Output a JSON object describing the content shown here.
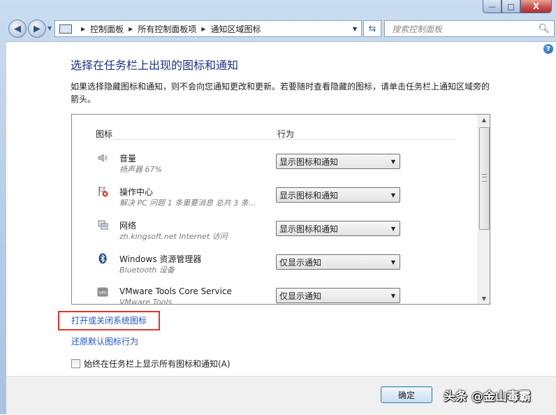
{
  "window": {
    "caption_buttons": {
      "minimize": "—",
      "maximize": "□",
      "close": "X"
    }
  },
  "nav": {
    "breadcrumbs": [
      "控制面板",
      "所有控制面板项",
      "通知区域图标"
    ],
    "search_placeholder": "搜索控制面板"
  },
  "page": {
    "title": "选择在任务栏上出现的图标和通知",
    "description": "如果选择隐藏图标和通知，则不会向您通知更改和更新。若要随时查看隐藏的图标，请单击任务栏上通知区域旁的箭头。"
  },
  "list": {
    "col_icon": "图标",
    "col_behavior": "行为",
    "rows": [
      {
        "icon": "speaker-icon",
        "name": "音量",
        "subtitle": "扬声器 67%",
        "behavior": "显示图标和通知"
      },
      {
        "icon": "action-center-icon",
        "name": "操作中心",
        "subtitle": "解决 PC 问题 1 条重要消息 总共 3 条...",
        "behavior": "显示图标和通知"
      },
      {
        "icon": "network-icon",
        "name": "网络",
        "subtitle": "zh.kingsoft.net Internet 访问",
        "behavior": "显示图标和通知"
      },
      {
        "icon": "bluetooth-icon",
        "name": "Windows 资源管理器",
        "subtitle": "Bluetooth 设备",
        "behavior": "仅显示通知"
      },
      {
        "icon": "vmware-icon",
        "name": "VMware Tools Core Service",
        "subtitle": "VMware Tools",
        "behavior": "仅显示通知"
      }
    ]
  },
  "links": {
    "system_icons": "打开或关闭系统图标",
    "restore_defaults": "还原默认图标行为"
  },
  "checkbox": {
    "label": "始终在任务栏上显示所有图标和通知(A)",
    "checked": false
  },
  "footer": {
    "ok": "确定",
    "watermark": "头条 @金山毒霸"
  },
  "colors": {
    "title": "#1e3287",
    "link": "#1f55c8",
    "highlight_box": "#e2332b"
  }
}
